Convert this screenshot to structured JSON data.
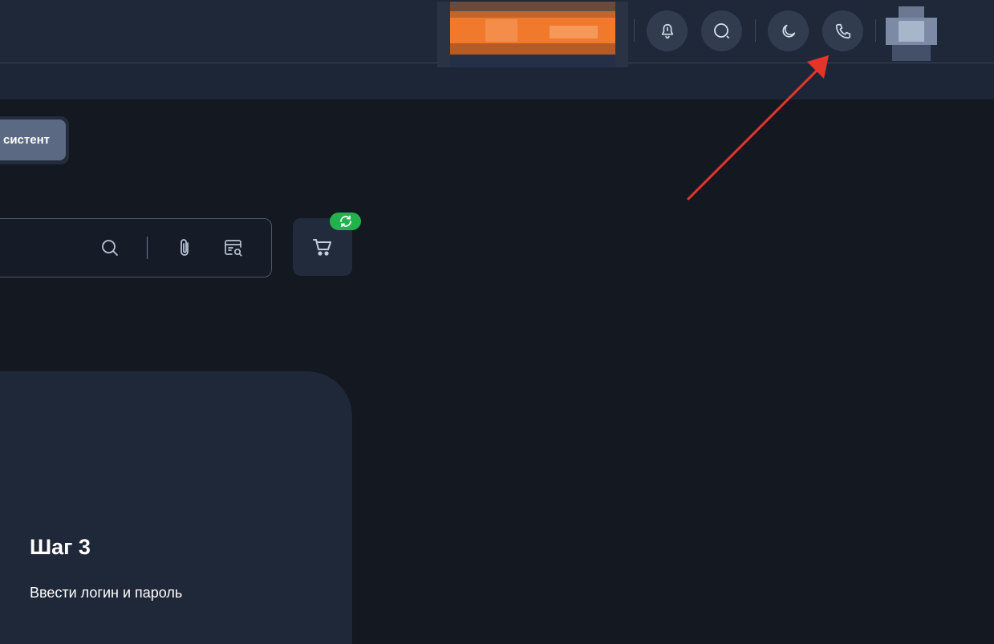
{
  "header": {
    "icons": {
      "notifications": "bell-icon",
      "search": "search-icon",
      "theme": "moon-icon",
      "call": "phone-icon"
    }
  },
  "assistant": {
    "label": "систент"
  },
  "search": {
    "icons": [
      "search-icon",
      "paperclip-icon",
      "catalog-search-icon"
    ]
  },
  "cart": {
    "icon": "cart-icon",
    "badge_icon": "refresh-icon"
  },
  "step": {
    "title": "Шаг 3",
    "text": "Ввести логин и пароль"
  },
  "colors": {
    "background": "#131821",
    "header": "#1f2839",
    "card": "#1f2839",
    "badge": "#22b24c",
    "annotation_arrow": "#e5352b",
    "banner": "#f07a22"
  }
}
